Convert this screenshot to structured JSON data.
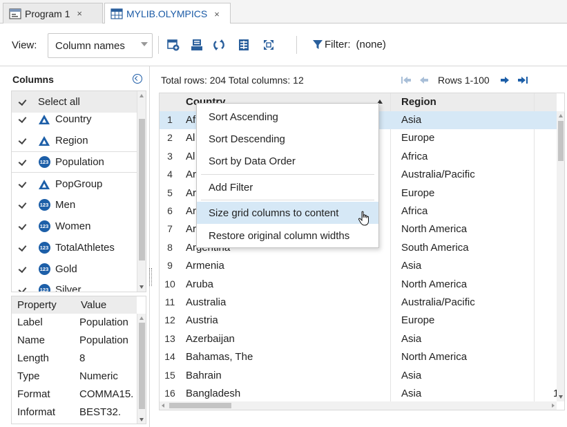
{
  "tabs": [
    {
      "label": "Program 1",
      "close": "×",
      "icon": "program-icon",
      "active": false
    },
    {
      "label": "MYLIB.OLYMPICS",
      "close": "×",
      "icon": "table-icon",
      "active": true
    }
  ],
  "toolbar": {
    "view_label": "View:",
    "view_value": "Column names",
    "icons": [
      "add-data-icon",
      "save-icon",
      "refresh-icon",
      "columns-icon",
      "expand-icon"
    ],
    "filter_label": "Filter:",
    "filter_value": "(none)"
  },
  "columns_panel": {
    "title": "Columns",
    "select_all": "Select all",
    "items": [
      {
        "name": "Country",
        "type": "char"
      },
      {
        "name": "Region",
        "type": "char"
      },
      {
        "name": "Population",
        "type": "num"
      },
      {
        "name": "PopGroup",
        "type": "char"
      },
      {
        "name": "Men",
        "type": "num"
      },
      {
        "name": "Women",
        "type": "num"
      },
      {
        "name": "TotalAthletes",
        "type": "num"
      },
      {
        "name": "Gold",
        "type": "num"
      },
      {
        "name": "Silver",
        "type": "num"
      }
    ],
    "num_icon_text": "123"
  },
  "properties": {
    "header_property": "Property",
    "header_value": "Value",
    "rows": [
      {
        "property": "Label",
        "value": "Population"
      },
      {
        "property": "Name",
        "value": "Population"
      },
      {
        "property": "Length",
        "value": "8"
      },
      {
        "property": "Type",
        "value": "Numeric"
      },
      {
        "property": "Format",
        "value": "COMMA15."
      },
      {
        "property": "Informat",
        "value": "BEST32."
      }
    ]
  },
  "grid": {
    "totals": "Total rows: 204  Total columns: 12",
    "rows_range": "Rows 1-100",
    "header_country": "Country",
    "header_region": "Region",
    "rows": [
      {
        "n": "1",
        "country": "Af",
        "region": "Asia",
        "extra": ""
      },
      {
        "n": "2",
        "country": "Al",
        "region": "Europe",
        "extra": ""
      },
      {
        "n": "3",
        "country": "Al",
        "region": "Africa",
        "extra": ""
      },
      {
        "n": "4",
        "country": "Ar",
        "region": "Australia/Pacific",
        "extra": ""
      },
      {
        "n": "5",
        "country": "Ar",
        "region": "Europe",
        "extra": ""
      },
      {
        "n": "6",
        "country": "Ar",
        "region": "Africa",
        "extra": ""
      },
      {
        "n": "7",
        "country": "Ar",
        "region": "North America",
        "extra": ""
      },
      {
        "n": "8",
        "country": "Argentina",
        "region": "South America",
        "extra": ""
      },
      {
        "n": "9",
        "country": "Armenia",
        "region": "Asia",
        "extra": ""
      },
      {
        "n": "10",
        "country": "Aruba",
        "region": "North America",
        "extra": ""
      },
      {
        "n": "11",
        "country": "Australia",
        "region": "Australia/Pacific",
        "extra": ""
      },
      {
        "n": "12",
        "country": "Austria",
        "region": "Europe",
        "extra": ""
      },
      {
        "n": "13",
        "country": "Azerbaijan",
        "region": "Asia",
        "extra": ""
      },
      {
        "n": "14",
        "country": "Bahamas, The",
        "region": "North America",
        "extra": ""
      },
      {
        "n": "15",
        "country": "Bahrain",
        "region": "Asia",
        "extra": ""
      },
      {
        "n": "16",
        "country": "Bangladesh",
        "region": "Asia",
        "extra": "1"
      }
    ]
  },
  "context_menu": {
    "items": [
      {
        "label": "Sort Ascending"
      },
      {
        "label": "Sort Descending"
      },
      {
        "label": "Sort by Data Order"
      },
      {
        "label": "Add Filter"
      },
      {
        "label": "Size grid columns to content"
      },
      {
        "label": "Restore original column widths"
      }
    ],
    "hovered_index": 4
  },
  "colors": {
    "accent": "#1a5aa6",
    "row_highlight": "#d6e8f6",
    "header_bg": "#ececec"
  }
}
